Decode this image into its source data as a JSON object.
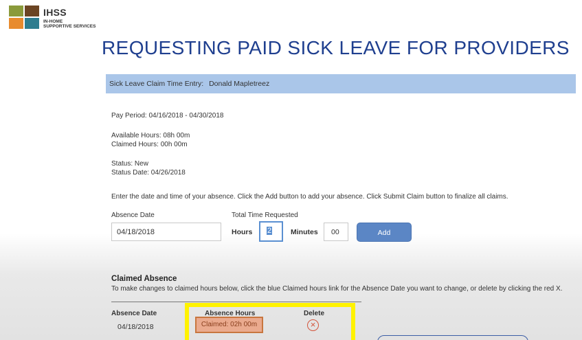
{
  "logo": {
    "name": "IHSS",
    "subtitle_line1": "IN-HOME",
    "subtitle_line2": "SUPPORTIVE SERVICES",
    "colors": [
      "#8a9a3b",
      "#6b4423",
      "#e88b2e",
      "#2e7d8f"
    ]
  },
  "page_title": "REQUESTING PAID SICK LEAVE FOR PROVIDERS",
  "entry_bar": {
    "label": "Sick Leave Claim Time Entry:",
    "provider_name": "Donald Mapletreez"
  },
  "info": {
    "pay_period": "Pay Period: 04/16/2018 - 04/30/2018",
    "available_hours": "Available Hours: 08h 00m",
    "claimed_hours": "Claimed Hours: 00h 00m",
    "status": "Status: New",
    "status_date": "Status Date: 04/26/2018",
    "instructions": "Enter the date and time of your absence. Click the Add button to add your absence. Click Submit Claim button to finalize all claims."
  },
  "form": {
    "absence_date_label": "Absence Date",
    "absence_date_value": "04/18/2018",
    "total_time_label": "Total Time Requested",
    "hours_label": "Hours",
    "hours_value": "2",
    "minutes_label": "Minutes",
    "minutes_value": "00",
    "add_button": "Add"
  },
  "claimed": {
    "title": "Claimed Absence",
    "description": "To make changes to claimed hours below, click the blue Claimed hours link for the Absence Date you want to change, or delete by clicking the red X.",
    "headers": {
      "date": "Absence Date",
      "hours": "Absence Hours",
      "delete": "Delete"
    },
    "rows": [
      {
        "date": "04/18/2018",
        "hours": "Claimed: 02h 00m"
      }
    ]
  },
  "icons": {
    "delete": "close-circle-icon"
  },
  "colors": {
    "title": "#1f3f8f",
    "entry_bar": "#aac6e9",
    "add_button": "#5b86c5",
    "highlight": "#fff200",
    "delete": "#d3543b"
  }
}
